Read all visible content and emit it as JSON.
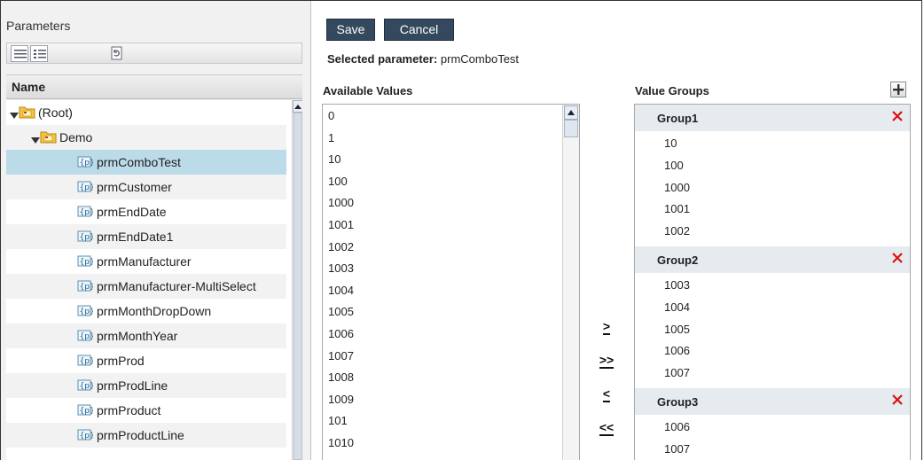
{
  "left_panel": {
    "title": "Parameters",
    "column_header": "Name",
    "tree": [
      {
        "label": "(Root)",
        "type": "folder",
        "level": 0,
        "expanded": true
      },
      {
        "label": "Demo",
        "type": "folder",
        "level": 1,
        "expanded": true
      },
      {
        "label": "prmComboTest",
        "type": "param",
        "level": 2,
        "selected": true
      },
      {
        "label": "prmCustomer",
        "type": "param",
        "level": 2
      },
      {
        "label": "prmEndDate",
        "type": "param",
        "level": 2
      },
      {
        "label": "prmEndDate1",
        "type": "param",
        "level": 2
      },
      {
        "label": "prmManufacturer",
        "type": "param",
        "level": 2
      },
      {
        "label": "prmManufacturer-MultiSelect",
        "type": "param",
        "level": 2
      },
      {
        "label": "prmMonthDropDown",
        "type": "param",
        "level": 2
      },
      {
        "label": "prmMonthYear",
        "type": "param",
        "level": 2
      },
      {
        "label": "prmProd",
        "type": "param",
        "level": 2
      },
      {
        "label": "prmProdLine",
        "type": "param",
        "level": 2
      },
      {
        "label": "prmProduct",
        "type": "param",
        "level": 2
      },
      {
        "label": "prmProductLine",
        "type": "param",
        "level": 2
      }
    ]
  },
  "toolbar": {
    "save_label": "Save",
    "cancel_label": "Cancel"
  },
  "selected_parameter": {
    "label": "Selected parameter:",
    "value": "prmComboTest"
  },
  "available_values": {
    "title": "Available Values",
    "items": [
      "0",
      "1",
      "10",
      "100",
      "1000",
      "1001",
      "1002",
      "1003",
      "1004",
      "1005",
      "1006",
      "1007",
      "1008",
      "1009",
      "101",
      "1010"
    ]
  },
  "move_buttons": {
    "add": ">",
    "add_all": ">>",
    "remove": "<",
    "remove_all": "<<"
  },
  "value_groups": {
    "title": "Value Groups",
    "groups": [
      {
        "name": "Group1",
        "values": [
          "10",
          "100",
          "1000",
          "1001",
          "1002"
        ]
      },
      {
        "name": "Group2",
        "values": [
          "1003",
          "1004",
          "1005",
          "1006",
          "1007"
        ]
      },
      {
        "name": "Group3",
        "values": [
          "1006",
          "1007"
        ]
      }
    ]
  },
  "colors": {
    "button_bg": "#34495e",
    "selected_row": "#bcdbe9",
    "group_header": "#e5ebef",
    "delete": "#dd1111"
  }
}
